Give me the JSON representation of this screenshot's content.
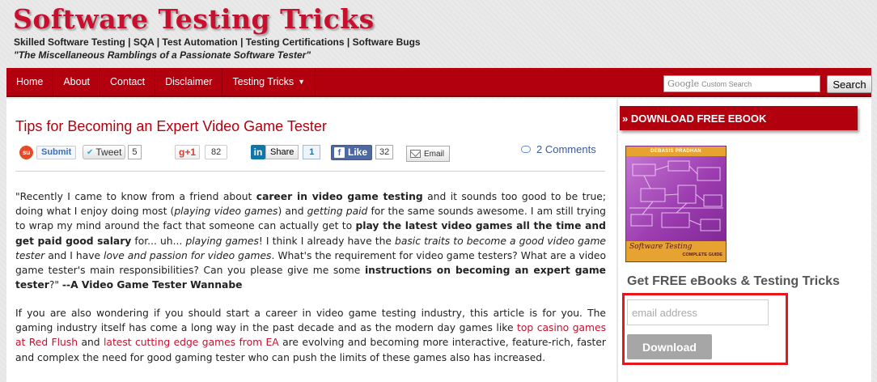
{
  "header": {
    "site_title": "Software Testing Tricks",
    "tagline": "Skilled Software Testing | SQA | Test Automation | Testing Certifications | Software Bugs",
    "motto": "\"The Miscellaneous Ramblings of a Passionate Software Tester\""
  },
  "nav": {
    "items": [
      "Home",
      "About",
      "Contact",
      "Disclaimer",
      "Testing Tricks"
    ],
    "dropdown_icon": "caret-down-icon",
    "search_google": "Google",
    "search_custom": "Custom Search",
    "search_button": "Search"
  },
  "post": {
    "title": "Tips for Becoming an Expert Video Game Tester",
    "share": {
      "stumble_label": "Submit",
      "tweet_label": "Tweet",
      "tweet_count": "5",
      "gplus_label": "g+1",
      "gplus_count": "82",
      "in_label": "in",
      "linkedin_label": "Share",
      "linkedin_count": "1",
      "fb_label": "Like",
      "fb_count": "32",
      "email_label": "Email"
    },
    "comments": "2 Comments",
    "p1": [
      {
        "t": "\"Recently I came to know from a friend about "
      },
      {
        "t": "career in video game testing",
        "s": "b"
      },
      {
        "t": " and it sounds too good to be true; doing what I enjoy doing most ("
      },
      {
        "t": "playing video games",
        "s": "i"
      },
      {
        "t": ") and "
      },
      {
        "t": "getting paid",
        "s": "i"
      },
      {
        "t": " for the same sounds awesome. I am still trying to wrap my mind around the fact that someone can actually get to "
      },
      {
        "t": "play the latest video games all the time and get paid good salary",
        "s": "b"
      },
      {
        "t": " for... uh... "
      },
      {
        "t": "playing games",
        "s": "i"
      },
      {
        "t": "! I think I already have the "
      },
      {
        "t": "basic traits to become a good video game tester",
        "s": "i"
      },
      {
        "t": " and I have "
      },
      {
        "t": "love and passion for video games",
        "s": "i"
      },
      {
        "t": ". What's the requirement for video game testers? What are a video game tester's main responsibilities? Can you please give me some "
      },
      {
        "t": "instructions on becoming an expert game tester",
        "s": "b"
      },
      {
        "t": "?\"  "
      },
      {
        "t": "--A Video Game Tester Wannabe",
        "s": "b"
      }
    ],
    "p2": [
      {
        "t": "If you are also wondering if you should start a career in video game testing industry, this article is for you. The gaming industry itself has come a long way in the past decade and as the modern day games like "
      },
      {
        "t": "top casino games at Red Flush",
        "s": "a"
      },
      {
        "t": " and "
      },
      {
        "t": "latest cutting edge games from EA",
        "s": "a"
      },
      {
        "t": " are evolving and becoming more interactive, feature-rich, faster and complex the need for good gaming tester who can push the limits of these games also has increased."
      }
    ]
  },
  "sidebar": {
    "heading": "» DOWNLOAD FREE EBOOK",
    "book_author": "DEBASIS PRADHAN",
    "book_title": "Software Testing",
    "book_subtitle": "COMPLETE GUIDE",
    "subscribe_title": "Get FREE eBooks & Testing Tricks",
    "email_placeholder": "email address",
    "download_label": "Download"
  },
  "colors": {
    "brand_red": "#b3000f",
    "title_red": "#c8102e",
    "highlight_red": "#e8151b"
  }
}
